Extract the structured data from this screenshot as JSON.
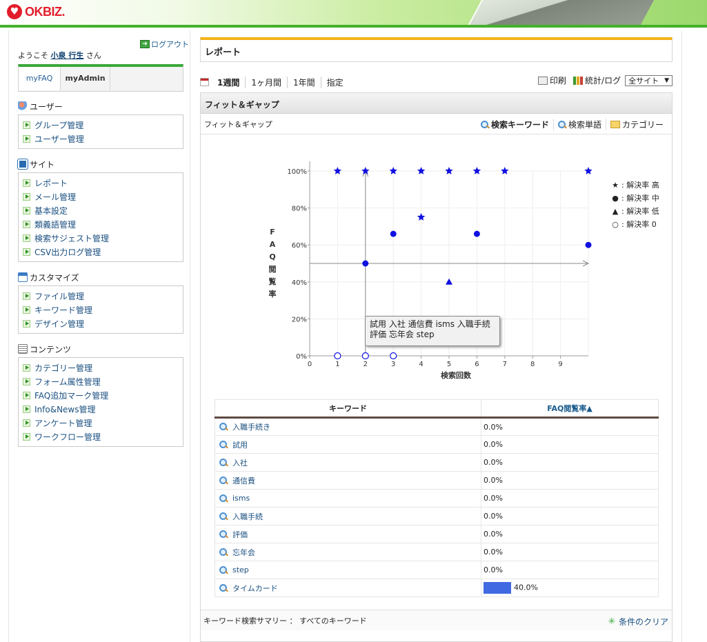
{
  "header": {
    "logo_text": "OKBIZ.",
    "logo_icon": "heart-icon"
  },
  "sidebar": {
    "logout_label": "ログアウト",
    "welcome_prefix": "ようこそ",
    "user_name": "小泉 行生",
    "welcome_suffix": "さん",
    "tabs": [
      {
        "label": "myFAQ"
      },
      {
        "label": "myAdmin"
      }
    ],
    "sections": [
      {
        "title": "ユーザー",
        "items": [
          {
            "label": "グループ管理"
          },
          {
            "label": "ユーザー管理"
          }
        ]
      },
      {
        "title": "サイト",
        "items": [
          {
            "label": "レポート"
          },
          {
            "label": "メール管理"
          },
          {
            "label": "基本設定"
          },
          {
            "label": "類義語管理"
          },
          {
            "label": "検索サジェスト管理"
          },
          {
            "label": "CSV出力ログ管理"
          }
        ]
      },
      {
        "title": "カスタマイズ",
        "items": [
          {
            "label": "ファイル管理"
          },
          {
            "label": "キーワード管理"
          },
          {
            "label": "デザイン管理"
          }
        ]
      },
      {
        "title": "コンテンツ",
        "items": [
          {
            "label": "カテゴリー管理"
          },
          {
            "label": "フォーム属性管理"
          },
          {
            "label": "FAQ追加マーク管理"
          },
          {
            "label": "Info&News管理"
          },
          {
            "label": "アンケート管理"
          },
          {
            "label": "ワークフロー管理"
          }
        ]
      }
    ]
  },
  "main": {
    "page_title": "レポート",
    "periods": [
      "1週間",
      "1ヶ月間",
      "1年間",
      "指定"
    ],
    "print_label": "印刷",
    "stats_label": "統計/ログ",
    "site_select": "全サイト",
    "panel_title": "フィット＆ギャップ",
    "sub_title": "フィット＆ギャップ",
    "sub_links": [
      "検索キーワード",
      "検索単語",
      "カテゴリー"
    ],
    "legend": [
      {
        "marker": "★",
        "label": ": 解決率 高"
      },
      {
        "marker": "●",
        "label": ": 解決率 中"
      },
      {
        "marker": "▲",
        "label": ": 解決率 低"
      },
      {
        "marker": "○",
        "label": ": 解決率 0"
      }
    ],
    "tooltip": {
      "line1": "試用 入社 通信費 isms 入職手続",
      "line2": "評価 忘年会 step"
    },
    "table": {
      "col_keyword": "キーワード",
      "col_rate": "FAQ閲覧率▲",
      "rows": [
        {
          "keyword": "入職手続き",
          "rate": "0.0%",
          "value": 0
        },
        {
          "keyword": "試用",
          "rate": "0.0%",
          "value": 0
        },
        {
          "keyword": "入社",
          "rate": "0.0%",
          "value": 0
        },
        {
          "keyword": "通信費",
          "rate": "0.0%",
          "value": 0
        },
        {
          "keyword": "isms",
          "rate": "0.0%",
          "value": 0
        },
        {
          "keyword": "入職手続",
          "rate": "0.0%",
          "value": 0
        },
        {
          "keyword": "評価",
          "rate": "0.0%",
          "value": 0
        },
        {
          "keyword": "忘年会",
          "rate": "0.0%",
          "value": 0
        },
        {
          "keyword": "step",
          "rate": "0.0%",
          "value": 0
        },
        {
          "keyword": "タイムカード",
          "rate": "40.0%",
          "value": 40
        }
      ]
    },
    "summary": "キーワード検索サマリー ： すべてのキーワード",
    "clear_label": "条件のクリア"
  },
  "chart_data": {
    "type": "scatter",
    "xlabel": "検索回数",
    "ylabel": "FAQ閲覧率",
    "xlim": [
      0,
      10
    ],
    "ylim": [
      0,
      100
    ],
    "x_ticks": [
      0,
      1,
      2,
      3,
      4,
      5,
      6,
      7,
      8,
      9
    ],
    "y_ticks": [
      "0%",
      "20%",
      "40%",
      "60%",
      "80%",
      "100%"
    ],
    "grid": true,
    "legend_position": "right",
    "colors": {
      "marker": "#1010e0",
      "axis": "#999999"
    },
    "crosshair": {
      "x": 2,
      "y": 50
    },
    "series": [
      {
        "name": "解決率 高",
        "marker": "star",
        "points": [
          [
            1,
            100
          ],
          [
            2,
            100
          ],
          [
            3,
            100
          ],
          [
            4,
            100
          ],
          [
            5,
            100
          ],
          [
            6,
            100
          ],
          [
            7,
            100
          ],
          [
            10,
            100
          ],
          [
            4,
            75
          ]
        ]
      },
      {
        "name": "解決率 中",
        "marker": "circle",
        "points": [
          [
            3,
            66
          ],
          [
            6,
            66
          ],
          [
            10,
            60
          ],
          [
            2,
            50
          ]
        ]
      },
      {
        "name": "解決率 低",
        "marker": "triangle",
        "points": [
          [
            5,
            40
          ]
        ]
      },
      {
        "name": "解決率 0",
        "marker": "hollow",
        "points": [
          [
            1,
            0
          ],
          [
            2,
            0
          ],
          [
            3,
            0
          ]
        ]
      }
    ]
  }
}
